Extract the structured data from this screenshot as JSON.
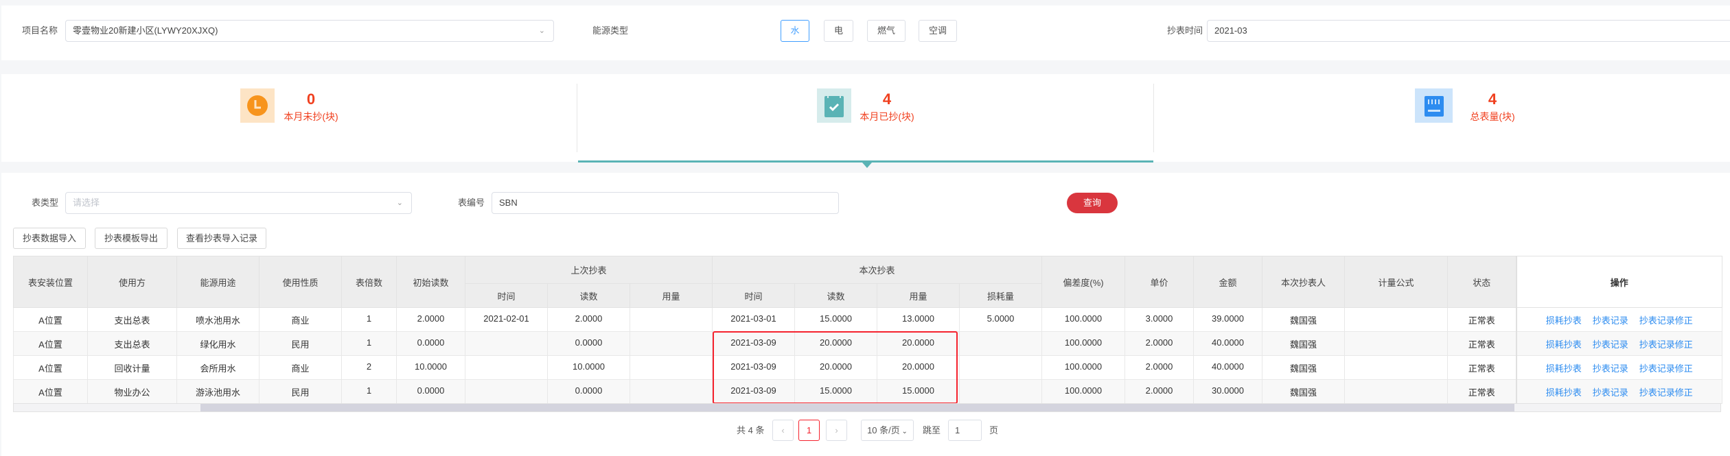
{
  "filters": {
    "project_label": "项目名称",
    "project_value": "零壹物业20新建小区(LYWY20XJXQ)",
    "energy_label": "能源类型",
    "energy_options": [
      "水",
      "电",
      "燃气",
      "空调"
    ],
    "energy_selected": "水",
    "time_label": "抄表时间",
    "time_value": "2021-03"
  },
  "stats": [
    {
      "value": "0",
      "label": "本月未抄(块)",
      "icon": "clock-icon"
    },
    {
      "value": "4",
      "label": "本月已抄(块)",
      "icon": "clipboard-check-icon",
      "active": true
    },
    {
      "value": "4",
      "label": "总表量(块)",
      "icon": "meter-icon"
    }
  ],
  "search": {
    "type_label": "表类型",
    "type_placeholder": "请选择",
    "code_label": "表编号",
    "code_value": "SBN",
    "query_label": "查询"
  },
  "toolbar": {
    "import": "抄表数据导入",
    "export": "抄表模板导出",
    "history": "查看抄表导入记录"
  },
  "table": {
    "headers": {
      "location": "表安装位置",
      "user": "使用方",
      "purpose": "能源用途",
      "nature": "使用性质",
      "multiplier": "表倍数",
      "initial": "初始读数",
      "last_group": "上次抄表",
      "current_group": "本次抄表",
      "time": "时间",
      "reading": "读数",
      "usage": "用量",
      "loss": "损耗量",
      "deviation": "偏差度(%)",
      "price": "单价",
      "amount": "金额",
      "reader": "本次抄表人",
      "formula": "计量公式",
      "status": "状态",
      "ops": "操作"
    },
    "rows": [
      [
        "A位置",
        "支出总表",
        "喷水池用水",
        "商业",
        "1",
        "2.0000",
        "2021-02-01",
        "2.0000",
        "",
        "2021-03-01",
        "15.0000",
        "13.0000",
        "5.0000",
        "100.0000",
        "3.0000",
        "39.0000",
        "魏国强",
        "",
        "正常表"
      ],
      [
        "A位置",
        "支出总表",
        "绿化用水",
        "民用",
        "1",
        "0.0000",
        "",
        "0.0000",
        "",
        "2021-03-09",
        "20.0000",
        "20.0000",
        "",
        "100.0000",
        "2.0000",
        "40.0000",
        "魏国强",
        "",
        "正常表"
      ],
      [
        "A位置",
        "回收计量",
        "会所用水",
        "商业",
        "2",
        "10.0000",
        "",
        "10.0000",
        "",
        "2021-03-09",
        "20.0000",
        "20.0000",
        "",
        "100.0000",
        "2.0000",
        "40.0000",
        "魏国强",
        "",
        "正常表"
      ],
      [
        "A位置",
        "物业办公",
        "游泳池用水",
        "民用",
        "1",
        "0.0000",
        "",
        "0.0000",
        "",
        "2021-03-09",
        "15.0000",
        "15.0000",
        "",
        "100.0000",
        "2.0000",
        "30.0000",
        "魏国强",
        "",
        "正常表"
      ]
    ],
    "ops": [
      "损耗抄表",
      "抄表记录",
      "抄表记录修正"
    ]
  },
  "pagination": {
    "total": "共 4 条",
    "current": "1",
    "page_size": "10 条/页",
    "goto_label": "跳至",
    "goto_value": "1",
    "page_suffix": "页"
  },
  "colors": {
    "accent": "#409eff",
    "active_tab": "#5ab3b5",
    "query": "#d9363e",
    "highlight": "#f5222d",
    "stat_text": "#f0401f",
    "link": "#2d8cf0"
  }
}
